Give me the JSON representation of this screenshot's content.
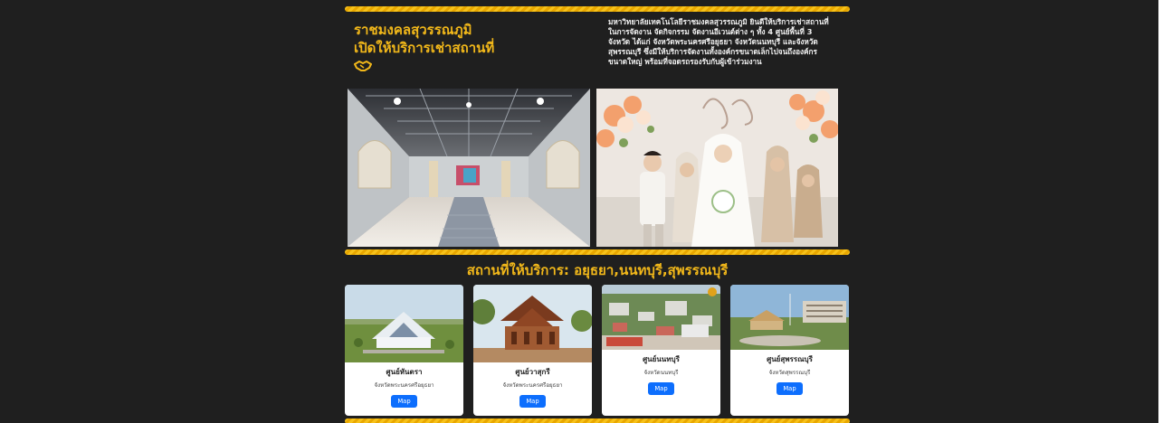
{
  "hero": {
    "title_line1": "ราชมงคลสุวรรณภูมิ",
    "title_line2": "เปิดให้บริการเช่าสถานที่",
    "intro_line1": "มหาวิทยาลัยเทคโนโลยีราชมงคลสุวรรณภูมิ ยินดีให้บริการเช่าสถานที่",
    "intro_line2": "ในการจัดงาน จัดกิจกรรม จัดงานอีเวนต์ต่าง ๆ ทั้ง 4 ศูนย์พื้นที่ 3",
    "intro_line3": "จังหวัด ได้แก่ จังหวัดพระนครศรีอยุธยา จังหวัดนนทบุรี และจังหวัด",
    "intro_line4": "สุพรรณบุรี ซึ่งมีให้บริการจัดงานทั้งองค์กรขนาดเล็กไปจนถึงองค์กร",
    "intro_line5": "ขนาดใหญ่ พร้อมที่จอดรถรองรับกับผู้เข้าร่วมงาน"
  },
  "section": {
    "title": "สถานที่ให้บริการ: อยุธยา,นนทบุรี,สุพรรณบุรี"
  },
  "centers": [
    {
      "name": "ศูนย์หันตรา",
      "province": "จังหวัดพระนครศรีอยุธยา",
      "button": "Map"
    },
    {
      "name": "ศูนย์วาสุกรี",
      "province": "จังหวัดพระนครศรีอยุธยา",
      "button": "Map"
    },
    {
      "name": "ศูนย์นนทบุรี",
      "province": "จังหวัดนนทบุรี",
      "button": "Map"
    },
    {
      "name": "ศูนย์สุพรรณบุรี",
      "province": "จังหวัดสุพรรณบุรี",
      "button": "Map"
    }
  ],
  "colors": {
    "background": "#1f1f1f",
    "accent": "#f2b81a",
    "button": "#0d6efd",
    "text_light": "#f1f1f1"
  },
  "icons": {
    "hero": "handshake-icon"
  }
}
